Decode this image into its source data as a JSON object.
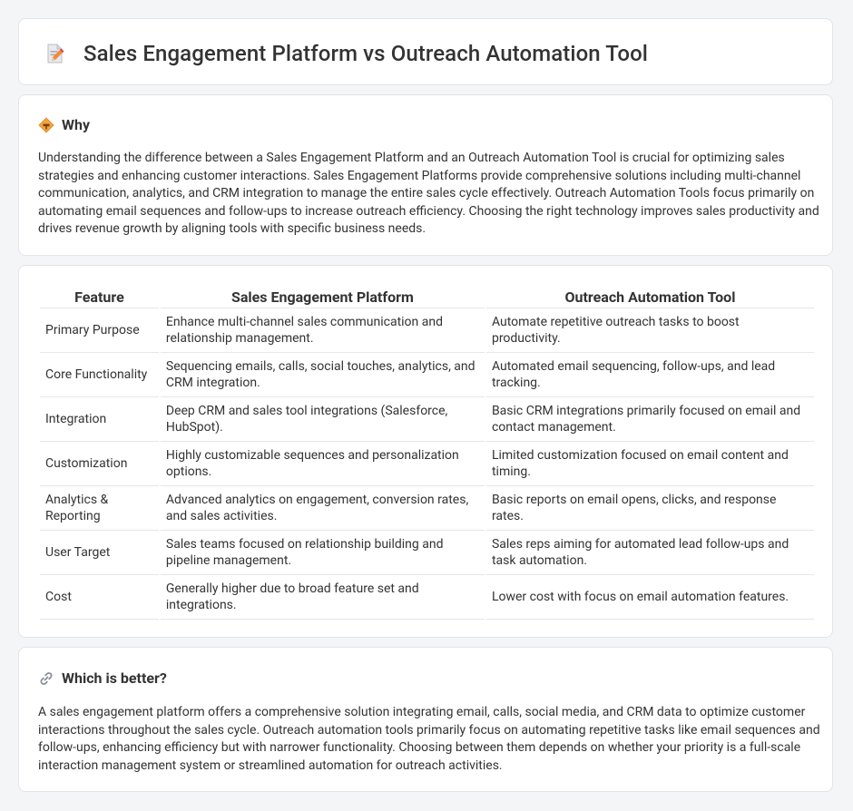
{
  "title": "Sales Engagement Platform vs Outreach Automation Tool",
  "why": {
    "heading": "Why",
    "text": "Understanding the difference between a Sales Engagement Platform and an Outreach Automation Tool is crucial for optimizing sales strategies and enhancing customer interactions. Sales Engagement Platforms provide comprehensive solutions including multi-channel communication, analytics, and CRM integration to manage the entire sales cycle effectively. Outreach Automation Tools focus primarily on automating email sequences and follow-ups to increase outreach efficiency. Choosing the right technology improves sales productivity and drives revenue growth by aligning tools with specific business needs."
  },
  "table": {
    "headers": [
      "Feature",
      "Sales Engagement Platform",
      "Outreach Automation Tool"
    ],
    "rows": [
      [
        "Primary Purpose",
        "Enhance multi-channel sales communication and relationship management.",
        "Automate repetitive outreach tasks to boost productivity."
      ],
      [
        "Core Functionality",
        "Sequencing emails, calls, social touches, analytics, and CRM integration.",
        "Automated email sequencing, follow-ups, and lead tracking."
      ],
      [
        "Integration",
        "Deep CRM and sales tool integrations (Salesforce, HubSpot).",
        "Basic CRM integrations primarily focused on email and contact management."
      ],
      [
        "Customization",
        "Highly customizable sequences and personalization options.",
        "Limited customization focused on email content and timing."
      ],
      [
        "Analytics & Reporting",
        "Advanced analytics on engagement, conversion rates, and sales activities.",
        "Basic reports on email opens, clicks, and response rates."
      ],
      [
        "User Target",
        "Sales teams focused on relationship building and pipeline management.",
        "Sales reps aiming for automated lead follow-ups and task automation."
      ],
      [
        "Cost",
        "Generally higher due to broad feature set and integrations.",
        "Lower cost with focus on email automation features."
      ]
    ]
  },
  "better": {
    "heading": "Which is better?",
    "text": "A sales engagement platform offers a comprehensive solution integrating email, calls, social media, and CRM data to optimize customer interactions throughout the sales cycle. Outreach automation tools primarily focus on automating repetitive tasks like email sequences and follow-ups, enhancing efficiency but with narrower functionality. Choosing between them depends on whether your priority is a full-scale interaction management system or streamlined automation for outreach activities."
  },
  "icons": {
    "title": "document-edit-icon",
    "why": "diamond-signpost-icon",
    "better": "link-icon"
  }
}
